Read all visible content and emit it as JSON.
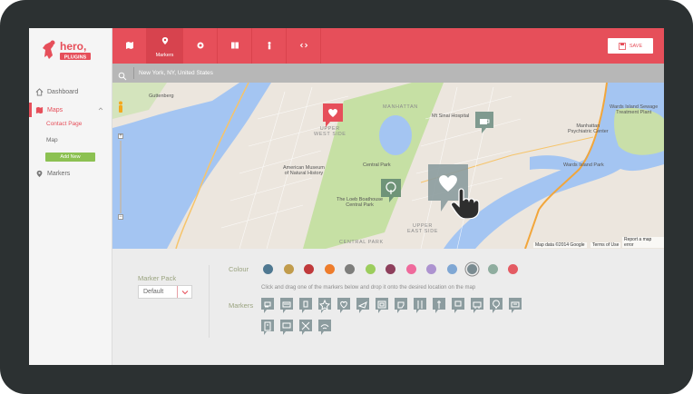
{
  "sidebar": {
    "logo_text": "hero,",
    "logo_subtext": "PLUGINS",
    "items": [
      {
        "label": "Dashboard",
        "icon": "home-icon"
      },
      {
        "label": "Maps",
        "icon": "map-icon"
      },
      {
        "label": "Markers",
        "icon": "pin-icon"
      }
    ],
    "sub_items": [
      {
        "label": "Contact Page"
      },
      {
        "label": "Map"
      }
    ],
    "add_button": "Add New"
  },
  "topbar": {
    "tabs": [
      {
        "icon": "map-icon",
        "label": ""
      },
      {
        "icon": "pin-icon",
        "label": "Markers"
      },
      {
        "icon": "target-icon",
        "label": ""
      },
      {
        "icon": "book-icon",
        "label": ""
      },
      {
        "icon": "person-icon",
        "label": ""
      },
      {
        "icon": "code-icon",
        "label": ""
      }
    ],
    "save_label": "SAVE"
  },
  "search": {
    "value": "New York, NY, United States"
  },
  "map": {
    "labels": {
      "guttenberg": "Guttenberg",
      "manhattan": "MANHATTAN",
      "upper_west": "UPPER\nWEST SIDE",
      "upper_east": "UPPER\nEAST SIDE",
      "central_park": "Central Park",
      "museum": "American Museum\nof Natural History",
      "boathouse": "The Loeb Boathouse\nCentral Park",
      "sinai": "Mt Sinai Hospital",
      "manhattan_psych": "Manhattan\nPsychiatric Center",
      "wards_treatment": "Wards Island Sewage\nTreatment Plant",
      "wards_park": "Wards Island Park",
      "midtown": "CENTRAL PARK"
    },
    "footer_data": "Map data ©2014 Google",
    "footer_terms": "Terms of Use",
    "footer_report": "Report a map error"
  },
  "panel": {
    "pack_label": "Marker Pack",
    "pack_value": "Default",
    "colour_label": "Colour",
    "markers_label": "Markers",
    "instruction": "Click and drag one of the markers below and drop it onto the desired location on the map",
    "colours": [
      "#4f7891",
      "#c19c4c",
      "#c0393b",
      "#ee7c2b",
      "#7e7e7c",
      "#9ccd5d",
      "#8e3f5c",
      "#ef6a9c",
      "#ad93d0",
      "#7fa7d4",
      "#7a8b91",
      "#8fad9f",
      "#e45b63"
    ],
    "selected_colour_index": 10
  },
  "colors": {
    "accent": "#e64f5a",
    "marker_grey": "#8c9c9f",
    "green": "#8cc152"
  }
}
